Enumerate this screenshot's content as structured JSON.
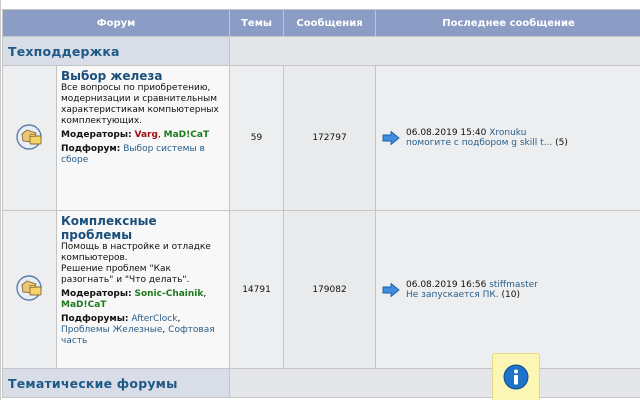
{
  "header": {
    "forum": "Форум",
    "topics": "Темы",
    "posts": "Сообщения",
    "last_post": "Последнее сообщение"
  },
  "categories": [
    {
      "title": "Техподдержка"
    },
    {
      "title": "Тематические форумы"
    }
  ],
  "forums": [
    {
      "title": "Выбор железа",
      "description": "Все вопросы по приобретению, модернизации и сравнительным характеристикам компьютерных комплектующих.",
      "moderators_label": "Модераторы:",
      "moderators": [
        "Varg",
        "MaD!CaT"
      ],
      "subforums_label": "Подфорум:",
      "subforums": [
        "Выбор системы в сборе"
      ],
      "topics": "59",
      "posts": "172797",
      "last": {
        "datetime": "06.08.2019 15:40",
        "user": "Xronuku",
        "topic": "помогите с подбором g skill t...",
        "count": "(5)"
      }
    },
    {
      "title": "Комплексные проблемы",
      "description": "Помощь в настройке и отладке компьютеров.",
      "description2": "Решение проблем \"Как разогнать\" и \"Что делать\".",
      "moderators_label": "Модераторы:",
      "moderators": [
        "Sonic-Chainik",
        "MaD!CaT"
      ],
      "subforums_label": "Подфорумы:",
      "subforums": [
        "AfterClock",
        "Проблемы Железные",
        "Софтовая часть"
      ],
      "topics": "14791",
      "posts": "179082",
      "last": {
        "datetime": "06.08.2019 16:56",
        "user": "stiffmaster",
        "topic": "Не запускается ПК.",
        "count": "(10)"
      }
    }
  ],
  "icons": {
    "forum": "forum-folder-icon",
    "last_post": "go-to-last-post-icon",
    "info": "info-icon"
  },
  "colors": {
    "header_bg": "#8b9dc4",
    "category_bg": "#d8dde7",
    "title": "#1b4f7c",
    "link": "#2a5e8a",
    "mod_red": "#a01010",
    "mod_green": "#1c7a1c",
    "info_bg": "#fbf6b3"
  }
}
